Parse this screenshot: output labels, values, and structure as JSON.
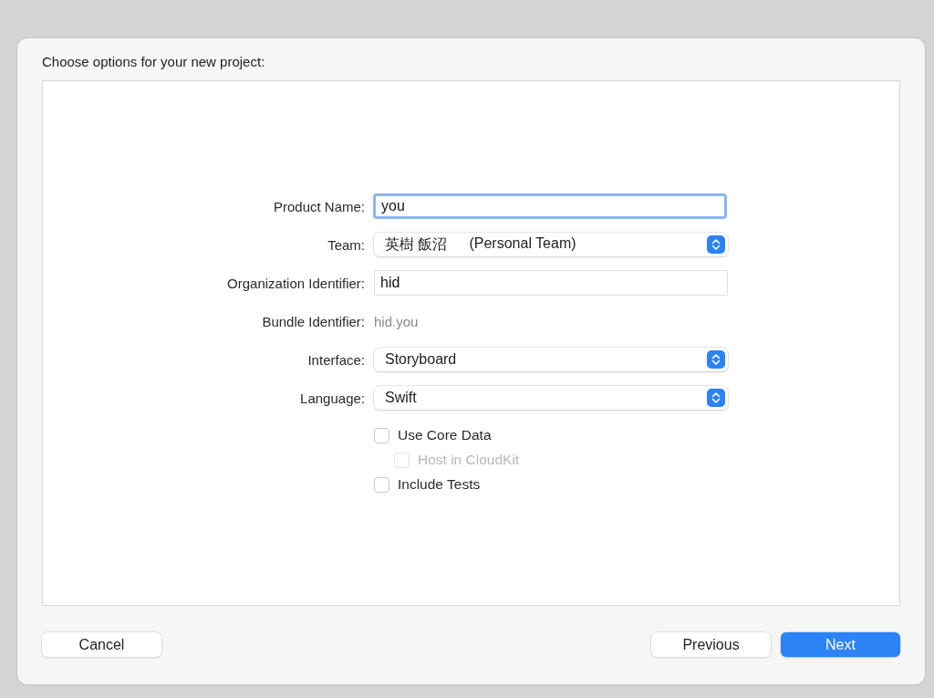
{
  "title": "Choose options for your new project:",
  "fields": [
    {
      "kind": "text",
      "label": "Product Name:",
      "value": "you",
      "focused": true
    },
    {
      "kind": "popup",
      "label": "Team:",
      "value": "英樹 飯沼",
      "note": "(Personal Team)"
    },
    {
      "kind": "text",
      "label": "Organization Identifier:",
      "value": "hid",
      "focused": false
    },
    {
      "kind": "static",
      "label": "Bundle Identifier:",
      "value": "hid.you"
    },
    {
      "kind": "popup",
      "label": "Interface:",
      "value": "Storyboard"
    },
    {
      "kind": "popup",
      "label": "Language:",
      "value": "Swift"
    }
  ],
  "checkboxes": [
    {
      "label": "Use Core Data",
      "checked": false,
      "disabled": false,
      "children": [
        {
          "label": "Host in CloudKit",
          "checked": false,
          "disabled": true
        }
      ]
    },
    {
      "label": "Include Tests",
      "checked": false,
      "disabled": false
    }
  ],
  "buttons_left": [
    {
      "label": "Cancel",
      "primary": false
    }
  ],
  "buttons_right": [
    {
      "label": "Previous",
      "primary": false
    },
    {
      "label": "Next",
      "primary": true
    }
  ]
}
